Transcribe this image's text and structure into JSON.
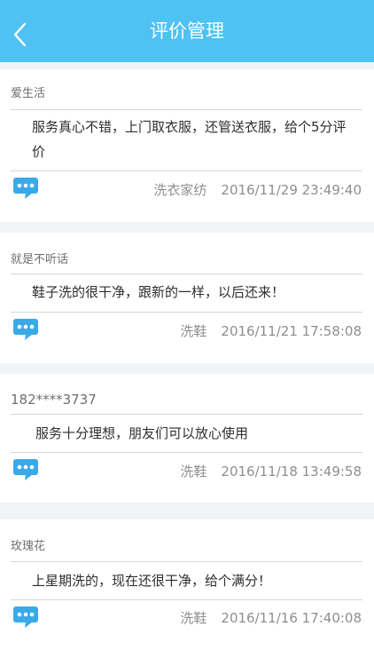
{
  "header": {
    "title": "评价管理"
  },
  "reviews": [
    {
      "user": "爱生活",
      "comment": "服务真心不错，上门取衣服，还管送衣服，给个5分评价",
      "service": "洗衣家纺",
      "time": "2016/11/29 23:49:40"
    },
    {
      "user": "就是不听话",
      "comment": "鞋子洗的很干净，跟新的一样，以后还来！",
      "service": "洗鞋",
      "time": "2016/11/21 17:58:08"
    },
    {
      "user": "182****3737",
      "comment": "服务十分理想，朋友们可以放心使用",
      "service": "洗鞋",
      "time": "2016/11/18 13:49:58"
    },
    {
      "user": "玫瑰花",
      "comment": "上星期洗的，现在还很干净，给个满分！",
      "service": "洗鞋",
      "time": "2016/11/16 17:40:08"
    }
  ],
  "colors": {
    "header": "#4fc1f3",
    "background": "#f0f4f7",
    "icon": "#3aa9e8"
  },
  "icons": {
    "back": "chevron-left-icon",
    "comment": "chat-bubble-icon"
  }
}
